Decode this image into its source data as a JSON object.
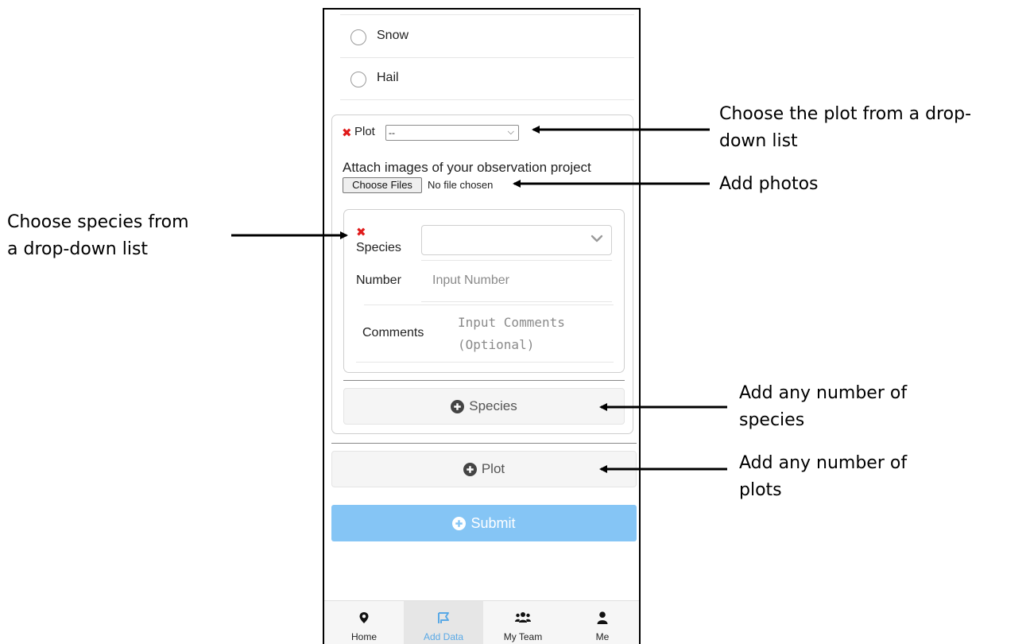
{
  "form": {
    "radio_options": [
      "Snow",
      "Hail"
    ],
    "plot_label": "Plot",
    "plot_select_value": "--",
    "attach_label": "Attach images of your observation project",
    "choose_files_label": "Choose Files",
    "file_status": "No file chosen",
    "species_label": "Species",
    "number_label": "Number",
    "number_placeholder": "Input Number",
    "comments_label": "Comments",
    "comments_placeholder_line1": "Input Comments",
    "comments_placeholder_line2": "(Optional)",
    "add_species_label": "Species",
    "add_plot_label": "Plot",
    "submit_label": "Submit",
    "submit_color": "#85c5f5",
    "required_marker_color": "#e01b1b"
  },
  "tabbar": {
    "tabs": [
      {
        "label": "Home",
        "icon": "map-pin-icon"
      },
      {
        "label": "Add Data",
        "icon": "flag-icon",
        "active": true
      },
      {
        "label": "My Team",
        "icon": "users-icon"
      },
      {
        "label": "Me",
        "icon": "user-icon"
      }
    ],
    "active_color": "#5aa9e6"
  },
  "annotations": {
    "plot_line1": "Choose the plot from a drop-",
    "plot_line2": "down list",
    "photos": "Add photos",
    "species_line1": "Choose species from",
    "species_line2": "a drop-down list",
    "add_species_line1": "Add any number of",
    "add_species_line2": "species",
    "add_plots_line1": "Add any number of",
    "add_plots_line2": "plots"
  }
}
